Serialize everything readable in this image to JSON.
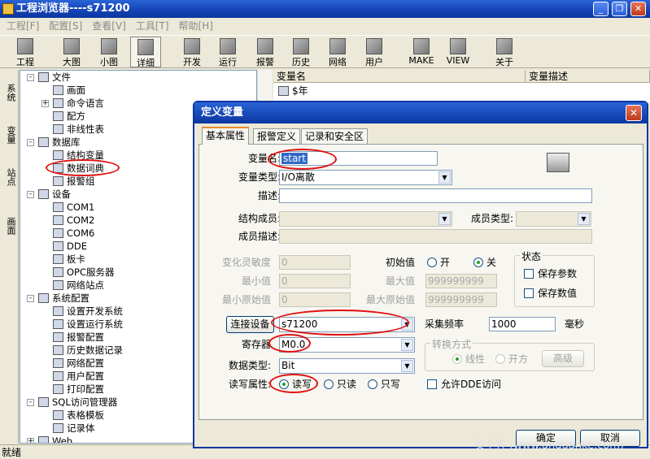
{
  "window": {
    "title": "工程浏览器----s71200"
  },
  "menu": [
    "工程[F]",
    "配置[S]",
    "查看[V]",
    "工具[T]",
    "帮助[H]"
  ],
  "toolbar": {
    "project": "工程",
    "large": "大图",
    "small": "小图",
    "detail": "详细",
    "develop": "开发",
    "run": "运行",
    "alarm": "报警",
    "history": "历史",
    "network": "网络",
    "user": "用户",
    "make": "MAKE",
    "view": "VIEW",
    "about": "关于"
  },
  "sidetabs": {
    "system": "系统",
    "variable": "变量",
    "station": "站点",
    "screen": "画面"
  },
  "tree": {
    "file": "文件",
    "screen": "画面",
    "cmdlang": "命令语言",
    "recipe": "配方",
    "nonlinear": "非线性表",
    "database": "数据库",
    "struct": "结构变量",
    "dict": "数据词典",
    "alarmgroup": "报警组",
    "device": "设备",
    "com1": "COM1",
    "com2": "COM2",
    "com6": "COM6",
    "dde": "DDE",
    "board": "板卡",
    "opc": "OPC服务器",
    "netstation": "网络站点",
    "syscfg": "系统配置",
    "devsys": "设置开发系统",
    "runsys": "设置运行系统",
    "alarmcfg": "报警配置",
    "histrec": "历史数据记录",
    "netcfg": "网络配置",
    "usercfg": "用户配置",
    "printcfg": "打印配置",
    "sql": "SQL访问管理器",
    "tabletpl": "表格模板",
    "recordset": "记录体",
    "web": "Web"
  },
  "rightpane": {
    "col_name": "变量名",
    "col_desc": "变量描述",
    "row1": "$年"
  },
  "status": "就绪",
  "dialog": {
    "title": "定义变量",
    "tabs": {
      "basic": "基本属性",
      "alarm": "报警定义",
      "record": "记录和安全区"
    },
    "name_label": "变量名:",
    "name_value": "start",
    "type_label": "变量类型:",
    "type_value": "I/O离散",
    "desc_label": "描述:",
    "struct_member_label": "结构成员:",
    "member_type_label": "成员类型:",
    "member_desc_label": "成员描述:",
    "sensitivity_label": "变化灵敏度",
    "sensitivity_value": "0",
    "initial_label": "初始值",
    "on": "开",
    "off": "关",
    "min_label": "最小值",
    "min_value": "0",
    "max_label": "最大值",
    "max_value": "999999999",
    "min_raw_label": "最小原始值",
    "min_raw_value": "0",
    "max_raw_label": "最大原始值",
    "max_raw_value": "999999999",
    "state_group": "状态",
    "save_param": "保存参数",
    "save_value": "保存数值",
    "device_button": "连接设备",
    "device_value": "s71200",
    "freq_label": "采集频率",
    "freq_value": "1000",
    "freq_unit": "毫秒",
    "register_label": "寄存器",
    "register_value": "M0.0",
    "conv_group": "转换方式",
    "linear": "线性",
    "sqrt": "开方",
    "advanced": "高级",
    "dtype_label": "数据类型:",
    "dtype_value": "Bit",
    "rw_label": "读写属性:",
    "rw": "读写",
    "ro": "只读",
    "wo": "只写",
    "dde_label": "允许DDE访问",
    "ok": "确定",
    "cancel": "取消"
  },
  "watermark": "安全客 (www.anquanke.com)",
  "colors": {
    "titlebar": "#0a36a0",
    "highlight": "#e01010",
    "selection": "#316ac5"
  }
}
